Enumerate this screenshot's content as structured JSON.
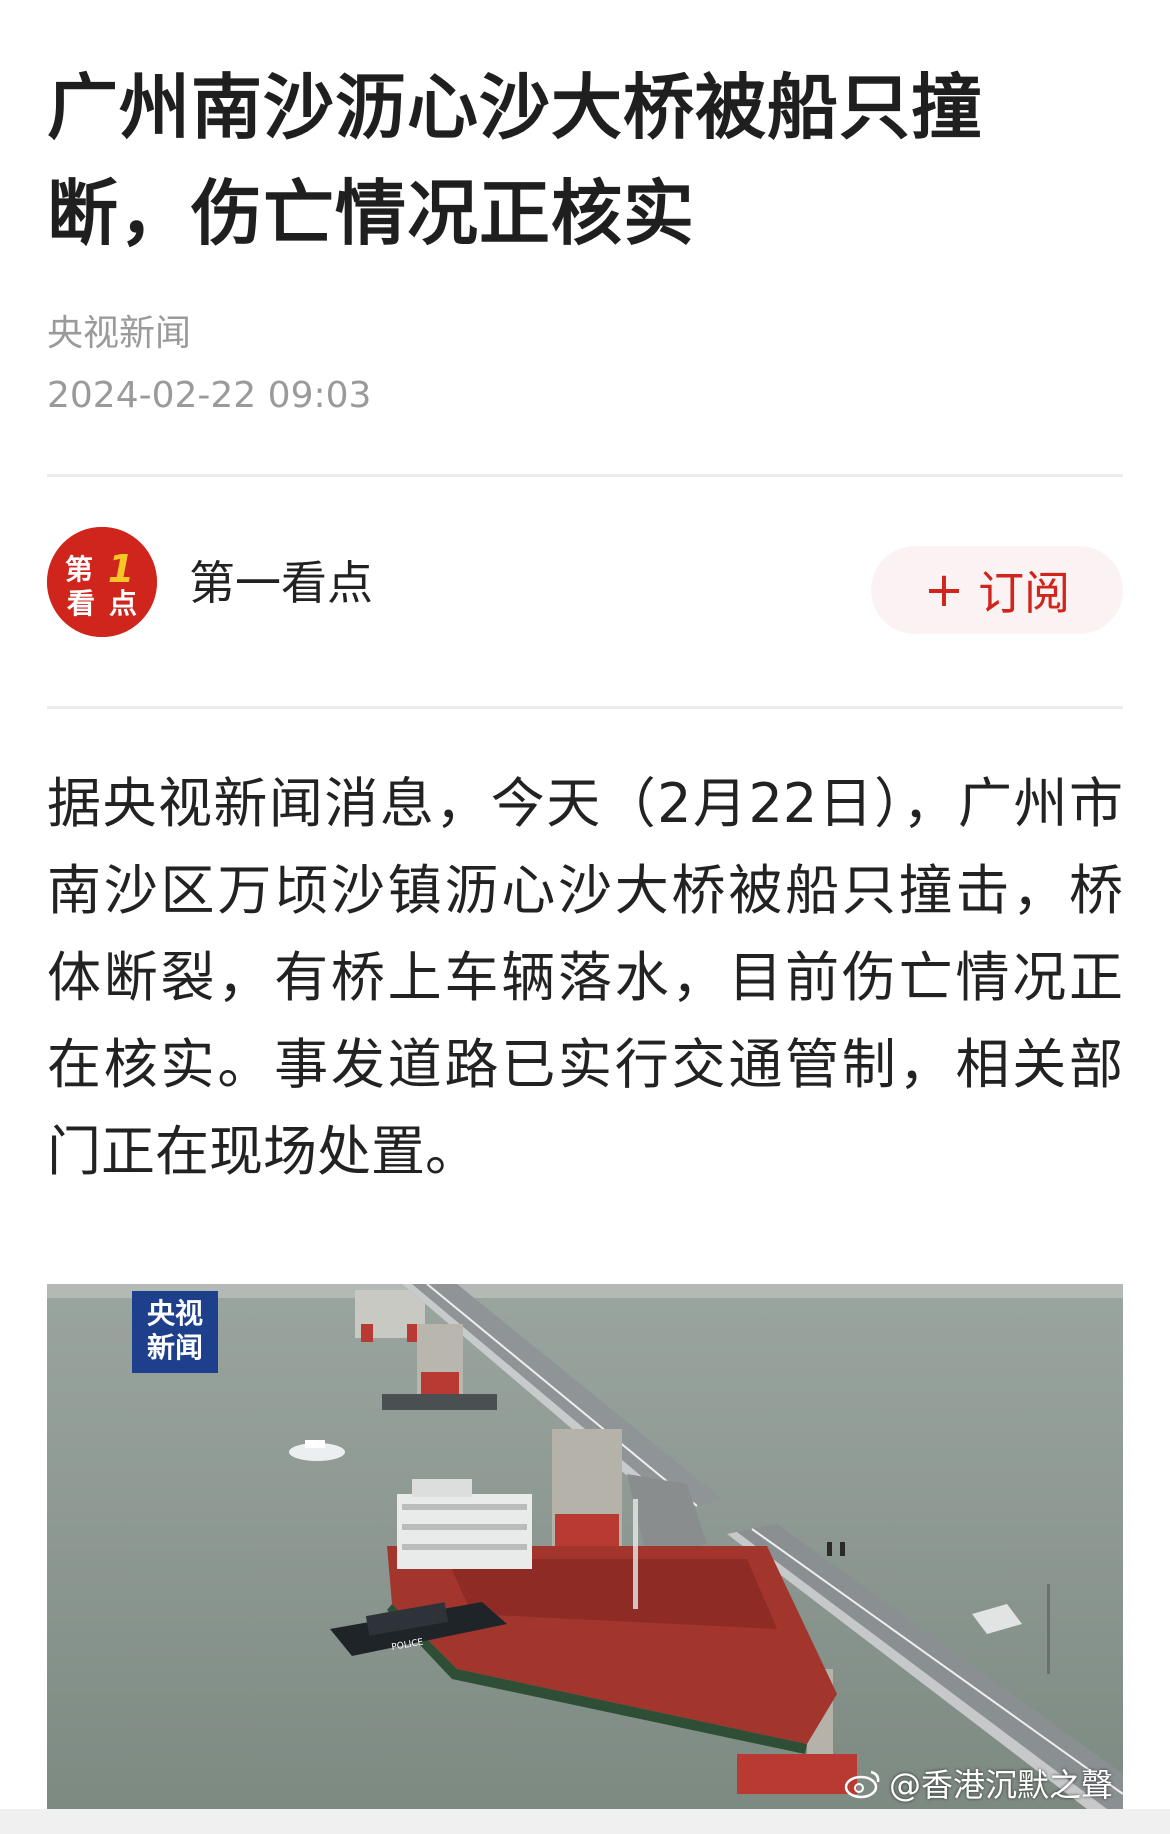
{
  "article": {
    "title": "广州南沙沥心沙大桥被船只撞断，伤亡情况正核实",
    "source": "央视新闻",
    "published_at": "2024-02-22 09:03",
    "body": "据央视新闻消息，今天（2月22日），广州市南沙区万顷沙镇沥心沙大桥被船只撞击，桥体断裂，有桥上车辆落水，目前伤亡情况正在核实。事发道路已实行交通管制，相关部门正在现场处置。"
  },
  "channel": {
    "name": "第一看点",
    "logo_text": "第1看点",
    "subscribe_plus": "+",
    "subscribe_label": "订阅"
  },
  "image": {
    "badge_line1": "央视",
    "badge_line2": "新闻",
    "police_marking": "POLICE",
    "watermark": "@香港沉默之聲",
    "watermark_icon": "weibo-icon"
  },
  "colors": {
    "brand_red": "#d0251c",
    "badge_blue": "#1d3f8c"
  }
}
